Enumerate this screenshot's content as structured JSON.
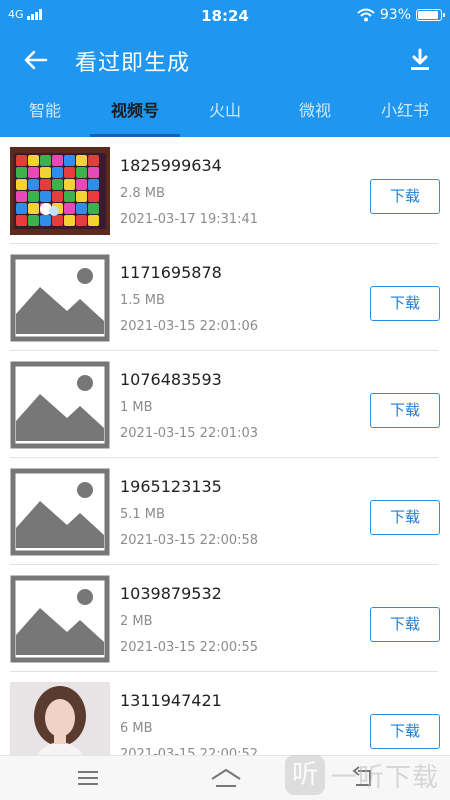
{
  "status_bar": {
    "network": "4G",
    "time": "18:24",
    "battery": "93%",
    "battery_level": 0.93
  },
  "toolbar": {
    "title": "看过即生成",
    "back_icon": "arrow-left-icon",
    "download_icon": "download-icon"
  },
  "tabs": [
    {
      "label": "智能",
      "active": false
    },
    {
      "label": "视频号",
      "active": true
    },
    {
      "label": "火山",
      "active": false
    },
    {
      "label": "微视",
      "active": false
    },
    {
      "label": "小红书",
      "active": false
    }
  ],
  "items": [
    {
      "thumbnail": "game-screenshot",
      "name": "1825999634",
      "size": "2.8 MB",
      "time": "2021-03-17 19:31:41",
      "button": "下载"
    },
    {
      "thumbnail": "image-placeholder-icon",
      "name": "1171695878",
      "size": "1.5 MB",
      "time": "2021-03-15 22:01:06",
      "button": "下载"
    },
    {
      "thumbnail": "image-placeholder-icon",
      "name": "1076483593",
      "size": "1 MB",
      "time": "2021-03-15 22:01:03",
      "button": "下载"
    },
    {
      "thumbnail": "image-placeholder-icon",
      "name": "1965123135",
      "size": "5.1 MB",
      "time": "2021-03-15 22:00:58",
      "button": "下载"
    },
    {
      "thumbnail": "image-placeholder-icon",
      "name": "1039879532",
      "size": "2 MB",
      "time": "2021-03-15 22:00:55",
      "button": "下载"
    },
    {
      "thumbnail": "person-photo",
      "name": "1311947421",
      "size": "6 MB",
      "time": "2021-03-15 22:00:52",
      "button": "下载"
    }
  ],
  "nav_bar": {
    "menu_icon": "menu-icon",
    "home_icon": "home-icon",
    "back_icon": "back-icon"
  },
  "watermark": {
    "logo": "听",
    "text": "一听下载"
  },
  "colors": {
    "primary": "#1f97f1",
    "tab_indicator": "#1562b5",
    "button_text": "#1f7ed6",
    "secondary_text": "#8c8c8c"
  }
}
